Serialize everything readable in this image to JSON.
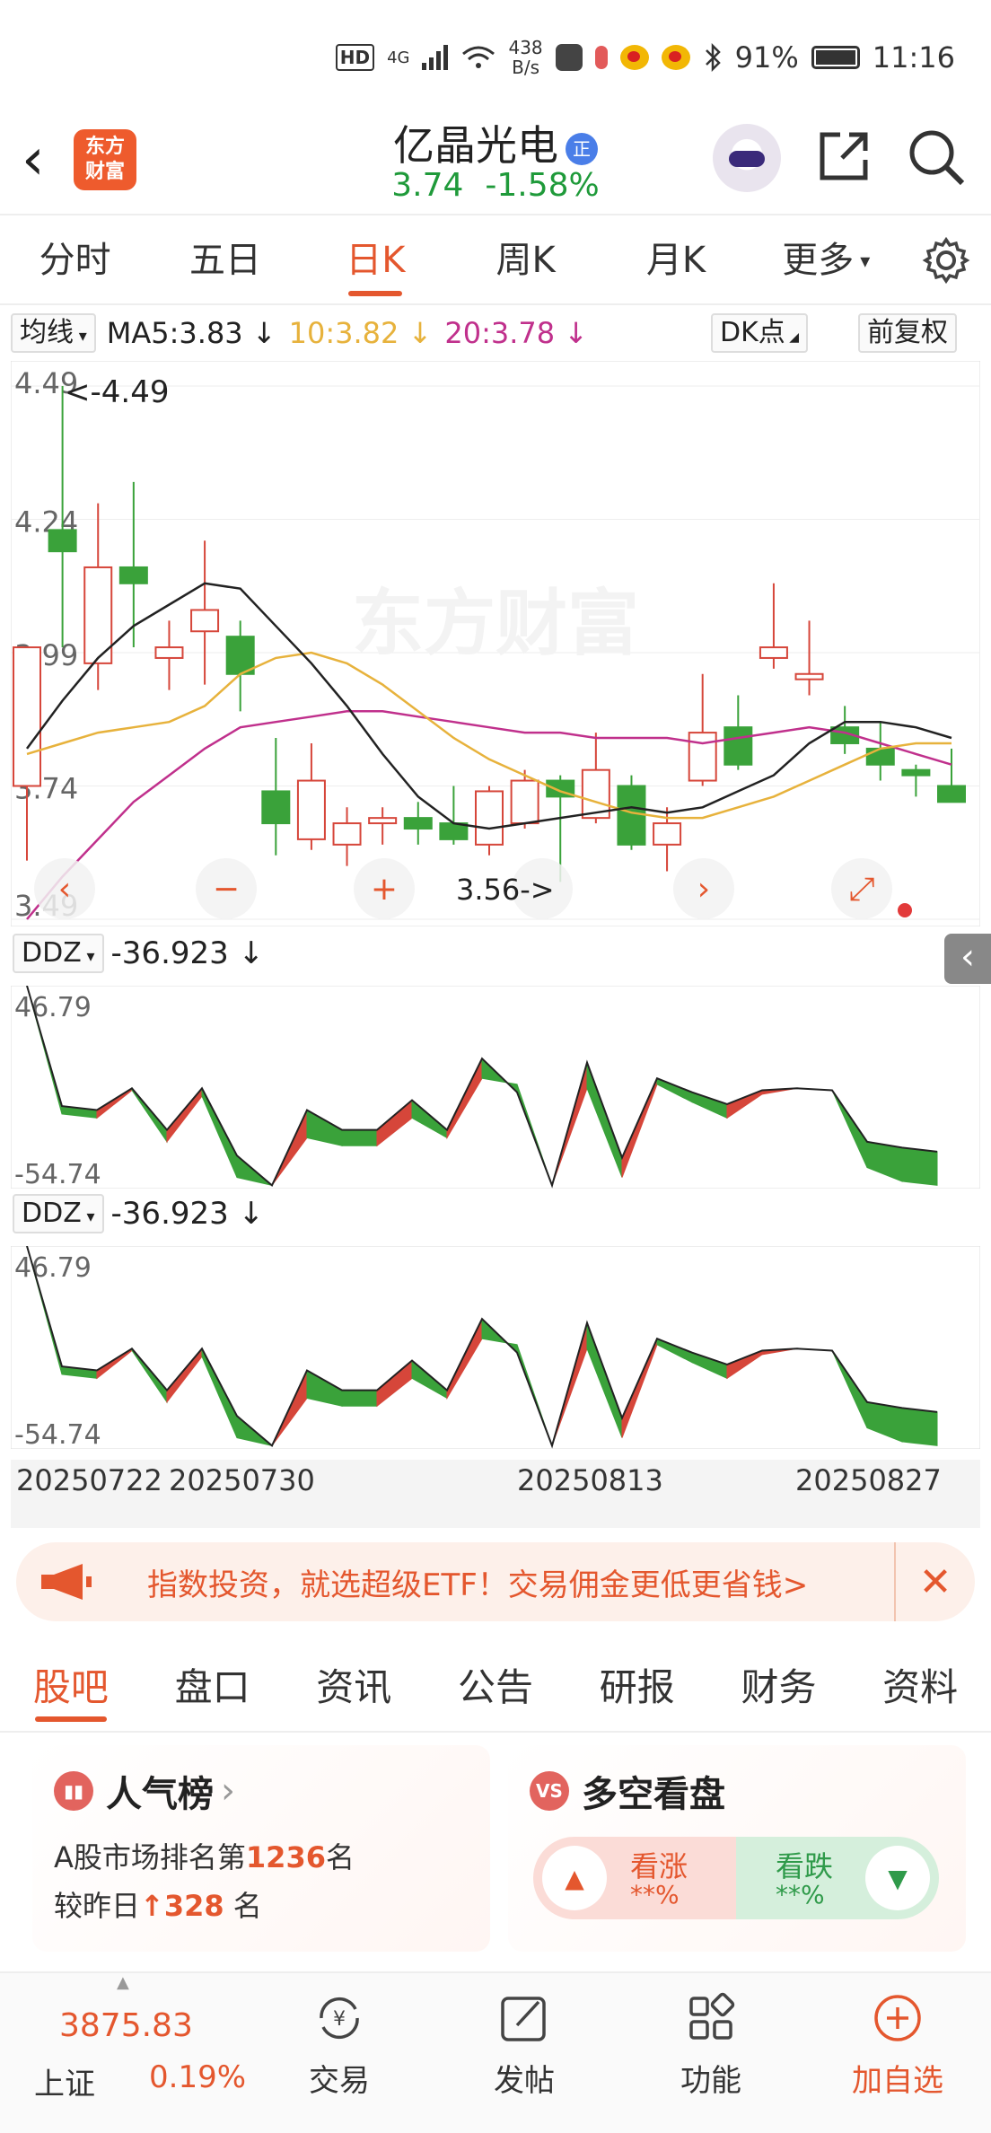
{
  "status_bar": {
    "hd": "HD",
    "speed_value": "438",
    "speed_unit": "B/s",
    "battery": "91%",
    "time": "11:16",
    "network": "4G"
  },
  "header": {
    "stock_name": "亿晶光电",
    "badge": "正",
    "price": "3.74",
    "change_pct": "-1.58%",
    "logo_line1": "东方",
    "logo_line2": "财富"
  },
  "period_tabs": [
    "分时",
    "五日",
    "日K",
    "周K",
    "月K",
    "更多"
  ],
  "active_period": "日K",
  "ma_row": {
    "selector": "均线",
    "ma5": "MA5:3.83",
    "ma10": "10:3.82",
    "ma20": "20:3.78",
    "dk_button": "DK点",
    "adjust_button": "前复权"
  },
  "kline": {
    "price_labels": [
      "4.49",
      "4.24",
      "3.99",
      "3.74",
      "3.49"
    ],
    "max_marker": "<-4.49",
    "min_marker": "3.56->",
    "watermark": "东方财富"
  },
  "indicators": [
    {
      "name": "DDZ",
      "value": "-36.923",
      "max": "46.79",
      "min": "-54.74"
    },
    {
      "name": "DDZ",
      "value": "-36.923",
      "max": "46.79",
      "min": "-54.74"
    }
  ],
  "date_axis": [
    "20250722",
    "20250730",
    "20250813",
    "20250827"
  ],
  "chart_data": {
    "type": "candlestick",
    "ylim": [
      3.49,
      4.49
    ],
    "candles": [
      {
        "o": 3.74,
        "h": 4.0,
        "l": 3.6,
        "c": 4.0,
        "dir": "up"
      },
      {
        "o": 4.22,
        "h": 4.49,
        "l": 4.0,
        "c": 4.18,
        "dir": "down"
      },
      {
        "o": 3.97,
        "h": 4.27,
        "l": 3.92,
        "c": 4.15,
        "dir": "up"
      },
      {
        "o": 4.15,
        "h": 4.31,
        "l": 4.0,
        "c": 4.12,
        "dir": "down"
      },
      {
        "o": 3.98,
        "h": 4.05,
        "l": 3.92,
        "c": 4.0,
        "dir": "up"
      },
      {
        "o": 4.03,
        "h": 4.2,
        "l": 3.93,
        "c": 4.07,
        "dir": "up"
      },
      {
        "o": 4.02,
        "h": 4.05,
        "l": 3.88,
        "c": 3.95,
        "dir": "down"
      },
      {
        "o": 3.73,
        "h": 3.83,
        "l": 3.61,
        "c": 3.67,
        "dir": "down"
      },
      {
        "o": 3.64,
        "h": 3.82,
        "l": 3.62,
        "c": 3.75,
        "dir": "up"
      },
      {
        "o": 3.63,
        "h": 3.7,
        "l": 3.59,
        "c": 3.67,
        "dir": "up"
      },
      {
        "o": 3.67,
        "h": 3.7,
        "l": 3.63,
        "c": 3.68,
        "dir": "up"
      },
      {
        "o": 3.68,
        "h": 3.71,
        "l": 3.63,
        "c": 3.66,
        "dir": "down"
      },
      {
        "o": 3.67,
        "h": 3.74,
        "l": 3.63,
        "c": 3.64,
        "dir": "down"
      },
      {
        "o": 3.63,
        "h": 3.74,
        "l": 3.61,
        "c": 3.73,
        "dir": "up"
      },
      {
        "o": 3.67,
        "h": 3.77,
        "l": 3.66,
        "c": 3.75,
        "dir": "up"
      },
      {
        "o": 3.75,
        "h": 3.76,
        "l": 3.56,
        "c": 3.72,
        "dir": "down"
      },
      {
        "o": 3.68,
        "h": 3.84,
        "l": 3.67,
        "c": 3.77,
        "dir": "up"
      },
      {
        "o": 3.74,
        "h": 3.76,
        "l": 3.62,
        "c": 3.63,
        "dir": "down"
      },
      {
        "o": 3.63,
        "h": 3.7,
        "l": 3.58,
        "c": 3.67,
        "dir": "up"
      },
      {
        "o": 3.75,
        "h": 3.95,
        "l": 3.74,
        "c": 3.84,
        "dir": "up"
      },
      {
        "o": 3.85,
        "h": 3.91,
        "l": 3.77,
        "c": 3.78,
        "dir": "down"
      },
      {
        "o": 3.98,
        "h": 4.12,
        "l": 3.96,
        "c": 4.0,
        "dir": "up"
      },
      {
        "o": 3.94,
        "h": 4.05,
        "l": 3.91,
        "c": 3.95,
        "dir": "up"
      },
      {
        "o": 3.85,
        "h": 3.89,
        "l": 3.8,
        "c": 3.82,
        "dir": "down"
      },
      {
        "o": 3.81,
        "h": 3.86,
        "l": 3.75,
        "c": 3.78,
        "dir": "down"
      },
      {
        "o": 3.77,
        "h": 3.78,
        "l": 3.72,
        "c": 3.76,
        "dir": "down"
      },
      {
        "o": 3.74,
        "h": 3.81,
        "l": 3.72,
        "c": 3.71,
        "dir": "down"
      }
    ],
    "ma5": [
      3.81,
      3.9,
      3.98,
      4.04,
      4.08,
      4.12,
      4.11,
      4.04,
      3.97,
      3.89,
      3.8,
      3.72,
      3.67,
      3.66,
      3.67,
      3.68,
      3.69,
      3.7,
      3.69,
      3.7,
      3.73,
      3.76,
      3.82,
      3.86,
      3.86,
      3.85,
      3.83
    ],
    "ma10": [
      3.8,
      3.82,
      3.84,
      3.85,
      3.86,
      3.89,
      3.95,
      3.98,
      3.99,
      3.97,
      3.93,
      3.88,
      3.83,
      3.79,
      3.76,
      3.73,
      3.71,
      3.69,
      3.68,
      3.68,
      3.7,
      3.72,
      3.75,
      3.78,
      3.81,
      3.82,
      3.82
    ],
    "ma20": [
      3.49,
      3.57,
      3.64,
      3.71,
      3.76,
      3.81,
      3.85,
      3.86,
      3.87,
      3.88,
      3.88,
      3.87,
      3.86,
      3.85,
      3.84,
      3.84,
      3.83,
      3.83,
      3.83,
      3.82,
      3.83,
      3.84,
      3.85,
      3.84,
      3.82,
      3.8,
      3.78
    ],
    "ddz_ylim": [
      -54.74,
      46.79
    ],
    "ddz": [
      46.79,
      -14,
      -16,
      -5,
      -26,
      -5,
      -39,
      -54,
      -16,
      -26,
      -26,
      -11,
      -26,
      10,
      -7,
      -54,
      8,
      -40,
      0,
      -7,
      -13,
      -6,
      -5,
      -6,
      -32,
      -35,
      -37
    ],
    "ddz_ref": [
      46.79,
      -18,
      -20,
      -6,
      -32,
      -9,
      -50,
      -54,
      -30,
      -34,
      -34,
      -20,
      -30,
      0,
      -3,
      -54,
      -5,
      -50,
      -3,
      -12,
      -20,
      -8,
      -5,
      -6,
      -45,
      -52,
      -54
    ]
  },
  "banner": {
    "text": "指数投资，就选超级ETF！交易佣金更低更省钱>"
  },
  "sub_tabs": [
    "股吧",
    "盘口",
    "资讯",
    "公告",
    "研报",
    "财务",
    "资料"
  ],
  "active_sub_tab": "股吧",
  "popularity": {
    "title": "人气榜",
    "rank_prefix": "A股市场排名第",
    "rank": "1236",
    "rank_suffix": "名",
    "change_prefix": "较昨日",
    "change": "328",
    "change_suffix": "名"
  },
  "bull_bear": {
    "title": "多空看盘",
    "up_label": "看涨",
    "up_pct": "**%",
    "down_label": "看跌",
    "down_pct": "**%"
  },
  "bottom_bar": {
    "index_value": "3875.83",
    "index_name": "上证",
    "index_pct": "0.19%",
    "items": [
      "交易",
      "发帖",
      "功能",
      "加自选"
    ]
  },
  "colors": {
    "accent": "#e4572e",
    "up": "#d6463a",
    "down": "#3aa23a",
    "ma5": "#222222",
    "ma10": "#e7b23c",
    "ma20": "#c0308c"
  }
}
